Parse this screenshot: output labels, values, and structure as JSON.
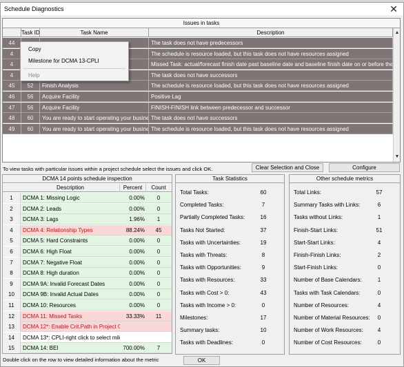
{
  "window": {
    "title": "Schedule Diagnostics"
  },
  "issues": {
    "title": "Issues in tasks",
    "headers": {
      "task_id": "Task ID",
      "task_name": "Task Name",
      "description": "Description"
    },
    "rows": [
      {
        "num": "44",
        "task_id": "",
        "name": "",
        "desc": "The task does not have predecessors"
      },
      {
        "num": "4",
        "task_id": "",
        "name": "",
        "desc": "The schedule is resource loaded, but this task does not have resources assigned"
      },
      {
        "num": "4",
        "task_id": "",
        "name": "",
        "desc": "Missed Task: actual/forecast finish date past baseline date and baseline finish date on or before the sta"
      },
      {
        "num": "4",
        "task_id": "",
        "name": "",
        "desc": "The task does not have successors"
      },
      {
        "num": "45",
        "task_id": "52",
        "name": "Finish Analysis",
        "desc": "The schedule is resource loaded, but this task does not have resources assigned"
      },
      {
        "num": "46",
        "task_id": "56",
        "name": "Acquire Facility",
        "desc": "Positive Lag"
      },
      {
        "num": "47",
        "task_id": "56",
        "name": "Acquire Facility",
        "desc": "FINISH-FINISH link between predecessor and successor"
      },
      {
        "num": "48",
        "task_id": "60",
        "name": "You are ready to start operating your busines",
        "desc": "The task does not have successors"
      },
      {
        "num": "49",
        "task_id": "60",
        "name": "You are ready to start operating your busines",
        "desc": "The schedule is resource loaded, but this task does not have resources assigned"
      }
    ]
  },
  "context_menu": {
    "items": [
      "Copy",
      "Milestone for DCMA 13-CPLI",
      "Help"
    ]
  },
  "hint": "To view tasks with particular issues within a project schedule select the issues and click OK.",
  "buttons": {
    "clear": "Clear Selection and Close",
    "configure": "Configure",
    "ok": "OK"
  },
  "dcma": {
    "title": "DCMA 14 points schedule inspection",
    "headers": {
      "description": "Description",
      "percent": "Percent",
      "count": "Count"
    },
    "rows": [
      {
        "n": "1",
        "desc": "DCMA 1: Missing Logic",
        "pct": "0.00%",
        "count": "0",
        "status": "green"
      },
      {
        "n": "2",
        "desc": "DCMA 2: Leads",
        "pct": "0.00%",
        "count": "0",
        "status": "green"
      },
      {
        "n": "3",
        "desc": "DCMA 3: Lags",
        "pct": "1.96%",
        "count": "1",
        "status": "green"
      },
      {
        "n": "4",
        "desc": "DCMA 4: Relationship Types",
        "pct": "88.24%",
        "count": "45",
        "status": "red"
      },
      {
        "n": "5",
        "desc": "DCMA 5: Hard Constraints",
        "pct": "0.00%",
        "count": "0",
        "status": "green"
      },
      {
        "n": "6",
        "desc": "DCMA 6: High Float",
        "pct": "0.00%",
        "count": "0",
        "status": "green"
      },
      {
        "n": "7",
        "desc": "DCMA 7: Negative Float",
        "pct": "0.00%",
        "count": "0",
        "status": "green"
      },
      {
        "n": "8",
        "desc": "DCMA 8: High duration",
        "pct": "0.00%",
        "count": "0",
        "status": "green"
      },
      {
        "n": "9",
        "desc": "DCMA 9A: Invalid Forecast Dates",
        "pct": "0.00%",
        "count": "0",
        "status": "green"
      },
      {
        "n": "10",
        "desc": "DCMA 9B: Invalid Actual Dates",
        "pct": "0.00%",
        "count": "0",
        "status": "green"
      },
      {
        "n": "11",
        "desc": "DCMA 10: Resources",
        "pct": "0.00%",
        "count": "0",
        "status": "green"
      },
      {
        "n": "12",
        "desc": "DCMA 11: Missed Tasks",
        "pct": "33.33%",
        "count": "11",
        "status": "red"
      },
      {
        "n": "13",
        "desc": "DCMA 12*: Enable Crit.Path in Project Opti",
        "pct": "",
        "count": "",
        "status": "red"
      },
      {
        "n": "14",
        "desc": "DCMA 13*: CPLI-right click to select milest",
        "pct": "",
        "count": "",
        "status": "white"
      },
      {
        "n": "15",
        "desc": "DCMA 14: BEI",
        "pct": "700.00%",
        "count": "7",
        "status": "green"
      }
    ],
    "footnote": "Double click on the row to view detailed information about the metric"
  },
  "task_stats": {
    "title": "Task Statistics",
    "rows": [
      {
        "label": "Total Tasks:",
        "value": "60"
      },
      {
        "label": "Completed Tasks:",
        "value": "7"
      },
      {
        "label": "Partially Completed Tasks:",
        "value": "16"
      },
      {
        "label": "Tasks Not Started:",
        "value": "37"
      },
      {
        "label": "Tasks with Uncertainties:",
        "value": "19"
      },
      {
        "label": "Tasks with Threats:",
        "value": "8"
      },
      {
        "label": "Tasks with Opportunities:",
        "value": "9"
      },
      {
        "label": "Tasks with Resources:",
        "value": "33"
      },
      {
        "label": "Tasks with Cost > 0:",
        "value": "43"
      },
      {
        "label": "Tasks with Income > 0:",
        "value": "0"
      },
      {
        "label": "Milestones:",
        "value": "17"
      },
      {
        "label": "Summary tasks:",
        "value": "10"
      },
      {
        "label": "Tasks with Deadlines:",
        "value": "0"
      }
    ]
  },
  "other_metrics": {
    "title": "Other schedule metrics",
    "rows": [
      {
        "label": "Total Links:",
        "value": "57"
      },
      {
        "label": "Summary Tasks with  Links:",
        "value": "6"
      },
      {
        "label": "Tasks without  Links:",
        "value": "1"
      },
      {
        "label": "Finish-Start  Links:",
        "value": "51"
      },
      {
        "label": "Start-Start  Links:",
        "value": "4"
      },
      {
        "label": "Finish-Finish Links:",
        "value": "2"
      },
      {
        "label": "Start-Finish Links:",
        "value": "0"
      },
      {
        "label": "Number of Base Calendars:",
        "value": "1"
      },
      {
        "label": "Tasks with Task Calendars:",
        "value": "0"
      },
      {
        "label": "Number of Resources:",
        "value": "4"
      },
      {
        "label": "Number of Material Resources:",
        "value": "0"
      },
      {
        "label": "Number of Work Resources:",
        "value": "4"
      },
      {
        "label": "Number of Cost Resources:",
        "value": "0"
      }
    ]
  }
}
